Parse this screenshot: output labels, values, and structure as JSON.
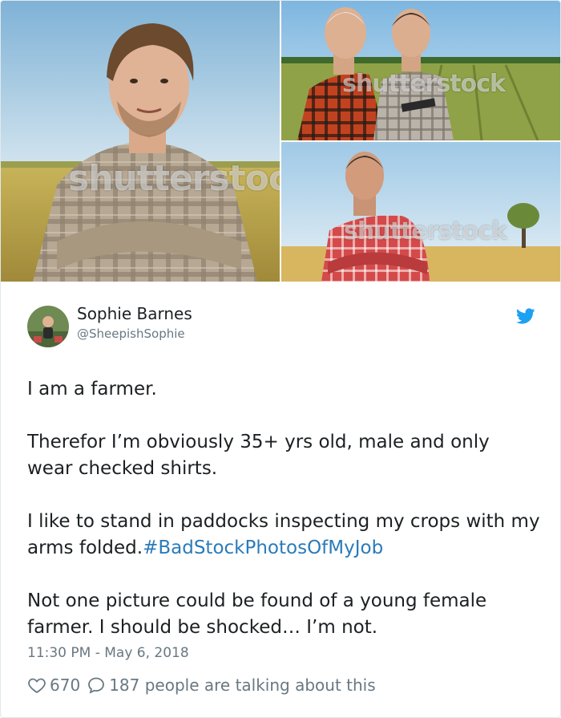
{
  "media": {
    "watermarks": {
      "left": "shutterstoc",
      "top_right": "shutterstock",
      "bottom_right": "shutterstock"
    }
  },
  "tweet": {
    "author": {
      "display_name": "Sophie Barnes",
      "handle": "@SheepishSophie"
    },
    "text": {
      "line1": "I am a farmer.",
      "line2": "Therefor I’m obviously 35+ yrs old, male and only wear checked shirts.",
      "line3": "I like to stand in paddocks inspecting my crops with my arms folded.",
      "hashtag": "#BadStockPhotosOfMyJob",
      "line4": "Not one picture could be found of a young female farmer. I should be shocked… I’m not."
    },
    "timestamp": "11:30 PM - May 6, 2018",
    "likes": "670",
    "replies": "187 people are talking about this"
  },
  "icons": {
    "brand": "twitter-bird-icon",
    "like": "heart-icon",
    "reply": "speech-bubble-icon"
  },
  "colors": {
    "brand_blue": "#1da1f2",
    "hashtag": "#2b7bb9",
    "secondary_text": "#697882",
    "primary_text": "#1c2022",
    "border": "#e1e8ed"
  }
}
